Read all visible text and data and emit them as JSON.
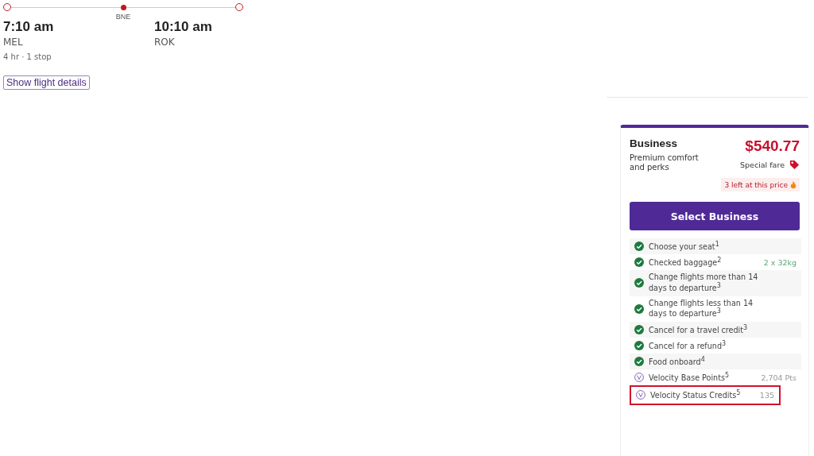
{
  "flight": {
    "depart_time": "7:10 am",
    "depart_code": "MEL",
    "stop_code": "BNE",
    "arrive_time": "10:10 am",
    "arrive_code": "ROK",
    "summary": "4 hr · 1 stop",
    "details_button": "Show flight details"
  },
  "fare": {
    "name": "Business",
    "description": "Premium comfort and perks",
    "price": "$540.77",
    "special": "Special fare",
    "availability": "3 left at this price",
    "select_button": "Select Business",
    "features": [
      {
        "kind": "check",
        "label": "Choose your seat$^{1}$",
        "highlighted": false
      },
      {
        "kind": "check",
        "label": "Checked baggage$^{2}$",
        "value": "2 x 32kg",
        "highlighted": false
      },
      {
        "kind": "check",
        "label": "Change flights more than 14 days to departure$^{3}$",
        "highlighted": false
      },
      {
        "kind": "check",
        "label": "Change flights less than 14 days to departure$^{3}$",
        "highlighted": false
      },
      {
        "kind": "check",
        "label": "Cancel for a travel credit$^{3}$",
        "highlighted": false
      },
      {
        "kind": "check",
        "label": "Cancel for a refund$^{3}$",
        "highlighted": false
      },
      {
        "kind": "check",
        "label": "Food onboard$^{4}$",
        "highlighted": false
      },
      {
        "kind": "velocity",
        "label": "Velocity Base Points$^{5}$",
        "value": "2,704 Pts",
        "highlighted": false
      },
      {
        "kind": "velocity",
        "label": "Velocity Status Credits$^{5}$",
        "value": "135",
        "highlighted": true
      }
    ]
  }
}
